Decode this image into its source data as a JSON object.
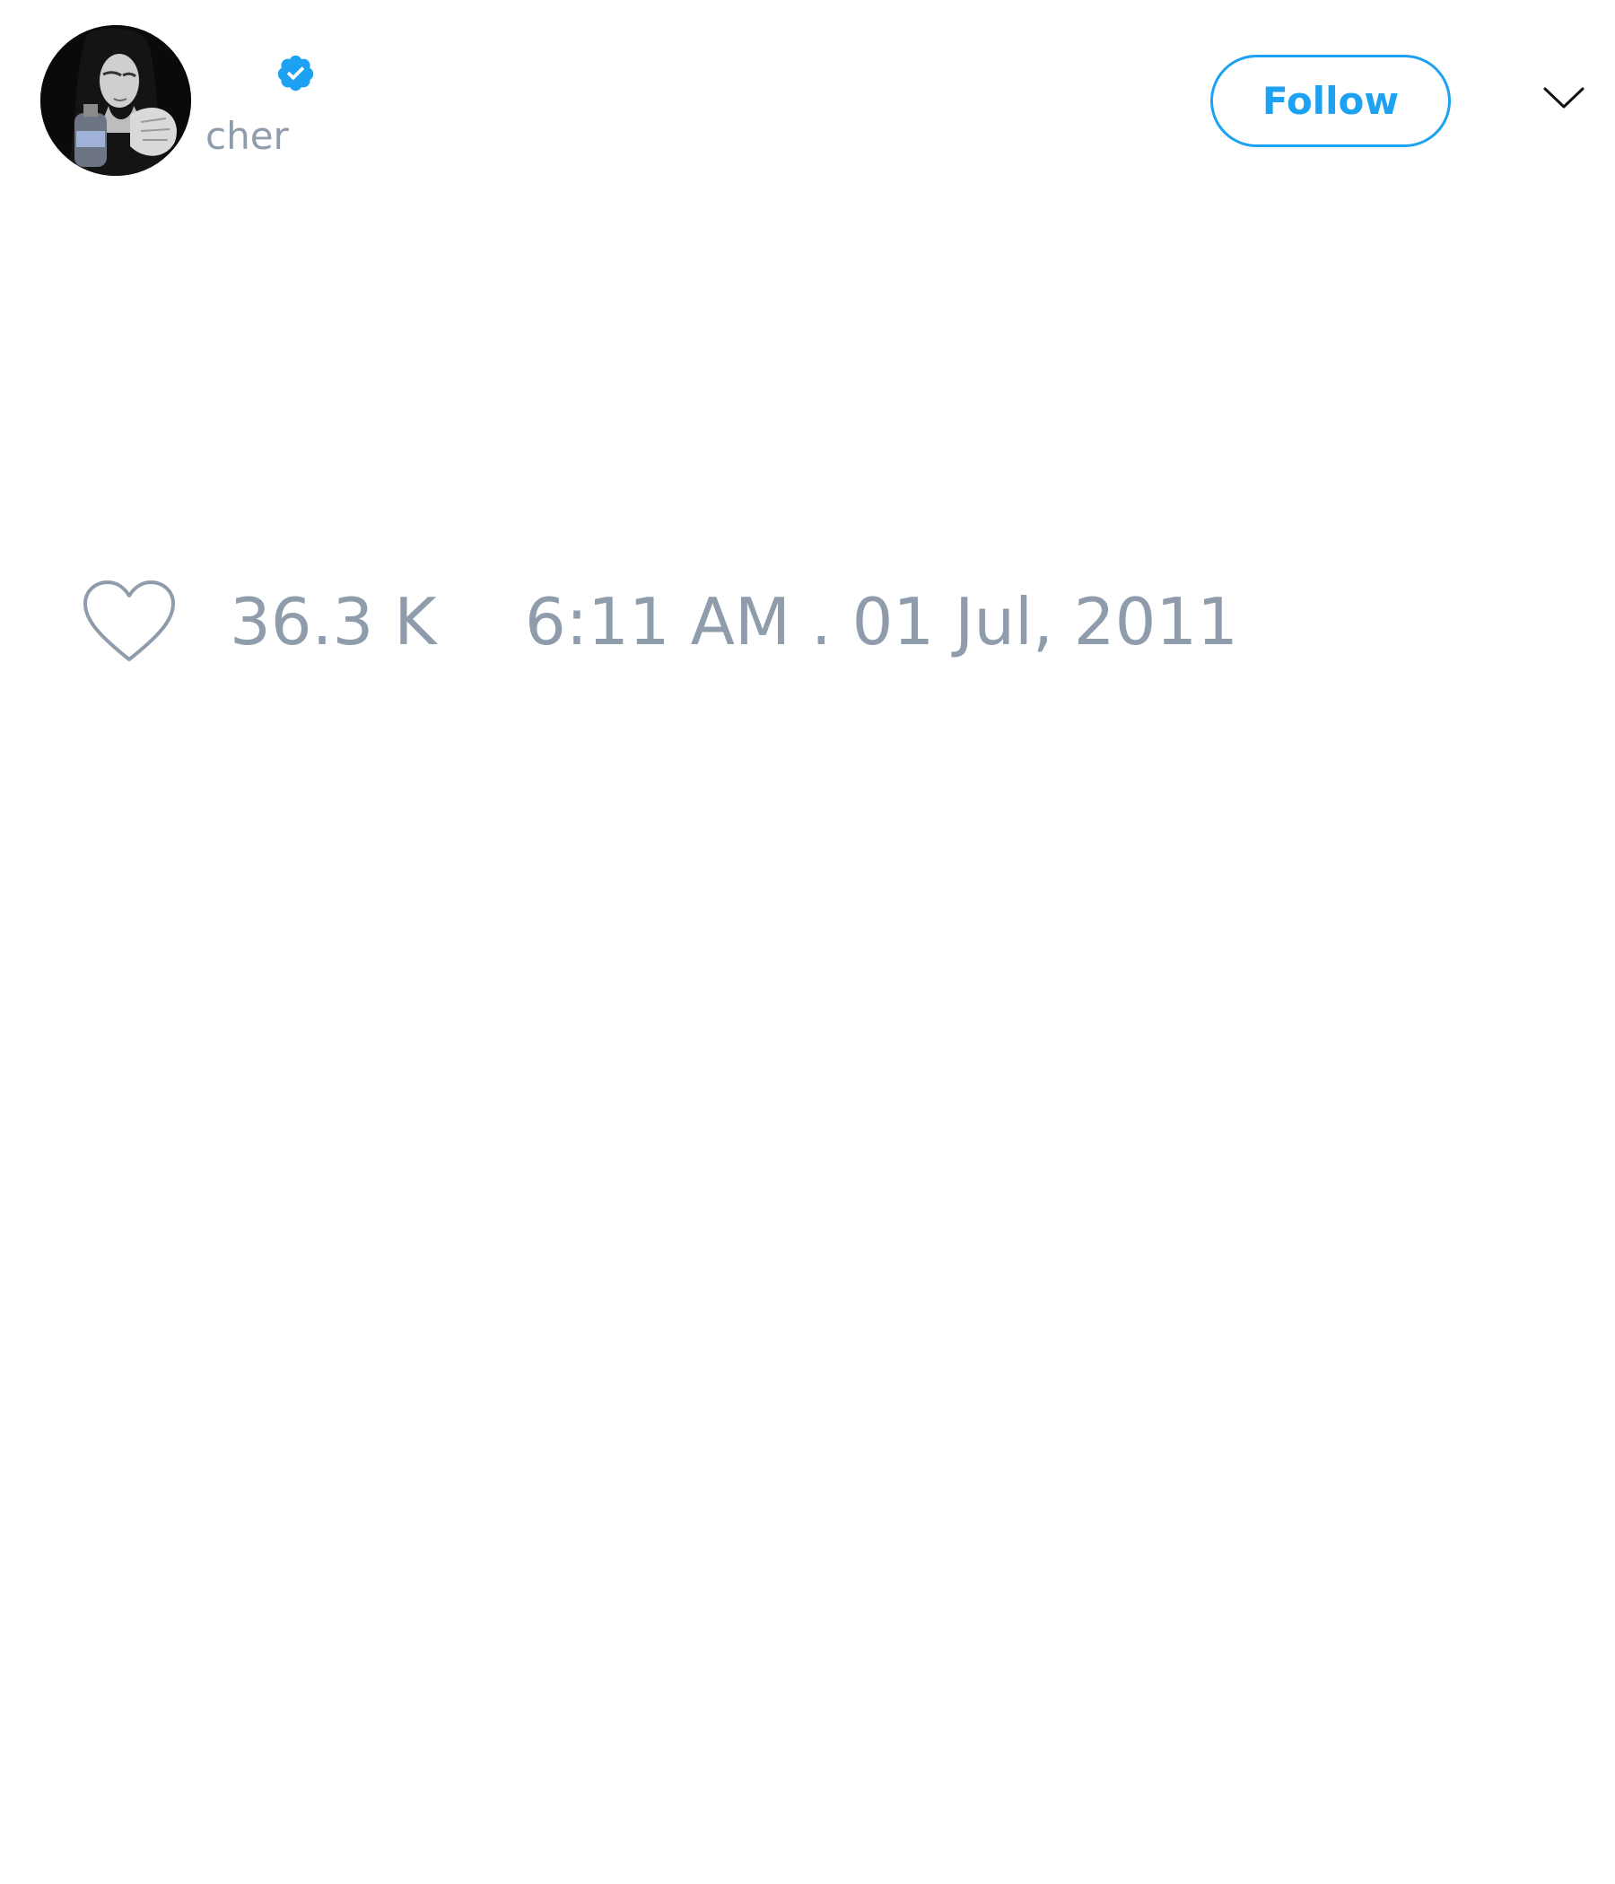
{
  "tweet": {
    "author": {
      "handle": "cher",
      "verified": true
    },
    "follow_label": "Follow",
    "likes": "36.3 K",
    "timestamp": "6:11 AM . 01 Jul, 2011"
  },
  "colors": {
    "accent": "#1da1f2",
    "muted_text": "#8f9cac",
    "background": "#ffffff"
  },
  "icons": {
    "avatar": "profile-photo",
    "verified": "verified-badge-icon",
    "menu": "chevron-down-icon",
    "like": "heart-icon"
  }
}
